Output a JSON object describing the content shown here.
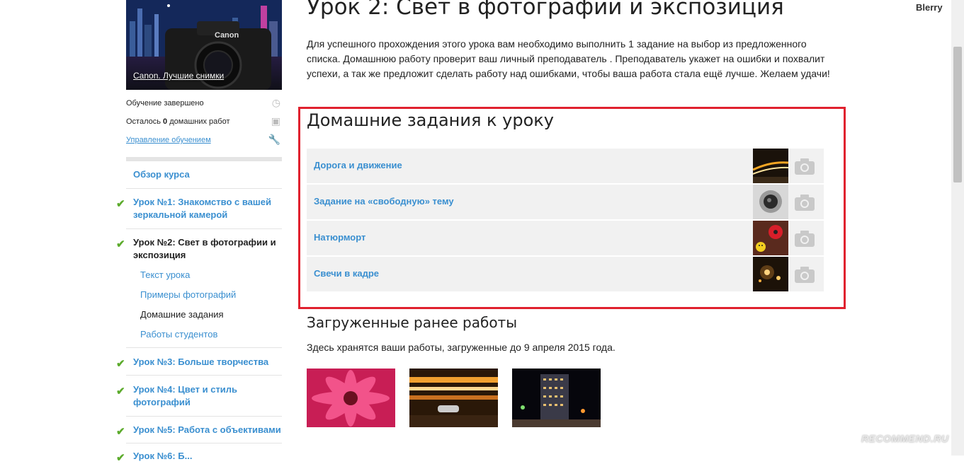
{
  "user": {
    "name": "Blerry"
  },
  "sidebar": {
    "course_link": "Canon. Лучшие снимки",
    "status": {
      "completed": "Обучение завершено",
      "remaining_prefix": "Осталось ",
      "remaining_count": "0",
      "remaining_suffix": " домашних работ",
      "manage": "Управление обучением"
    },
    "overview": "Обзор курса",
    "lessons": [
      {
        "label": "Урок №1: Знакомство с вашей зеркальной камерой",
        "done": true
      },
      {
        "label": "Урок №2: Свет в фотографии и экспозиция",
        "done": true,
        "current": true,
        "subitems": [
          "Текст урока",
          "Примеры фотографий",
          "Домашние задания",
          "Работы студентов"
        ],
        "active_subitem": "Домашние задания"
      },
      {
        "label": "Урок №3: Больше творчества",
        "done": true
      },
      {
        "label": "Урок №4: Цвет и стиль фотографий",
        "done": true
      },
      {
        "label": "Урок №5: Работа с объективами",
        "done": true
      },
      {
        "label": "Урок №6: Б...",
        "done": true
      }
    ]
  },
  "main": {
    "title": "Урок 2: Свет в фотографии и экспозиция",
    "intro": "Для успешного прохождения этого урока вам необходимо выполнить 1 задание на выбор из предложенного списка. Домашнюю работу проверит ваш личный преподаватель . Преподаватель укажет на ошибки и похвалит успехи, а так же предложит сделать работу над ошибками, чтобы ваша работа стала ещё лучше. Желаем удачи!",
    "homework_title": "Домашние задания к уроку",
    "tasks": [
      {
        "label": "Дорога и движение",
        "thumb_icon": "road-night-photo"
      },
      {
        "label": "Задание на «свободную» тему",
        "thumb_icon": "lens-photo"
      },
      {
        "label": "Натюрморт",
        "thumb_icon": "flower-smiley-photo"
      },
      {
        "label": "Свечи в кадре",
        "thumb_icon": "candles-photo"
      }
    ],
    "uploaded_title": "Загруженные ранее работы",
    "uploaded_note": "Здесь хранятся ваши работы, загруженные до 9 апреля 2015 года.",
    "uploaded_photos": [
      "pink-gerbera-photo",
      "car-motion-blur-photo",
      "night-building-photo"
    ]
  },
  "watermark": "RECOMMEND.RU",
  "colors": {
    "link": "#3a8fd0",
    "check": "#5cab2c",
    "highlight_border": "#e0212e",
    "row_bg": "#f1f1f1"
  }
}
